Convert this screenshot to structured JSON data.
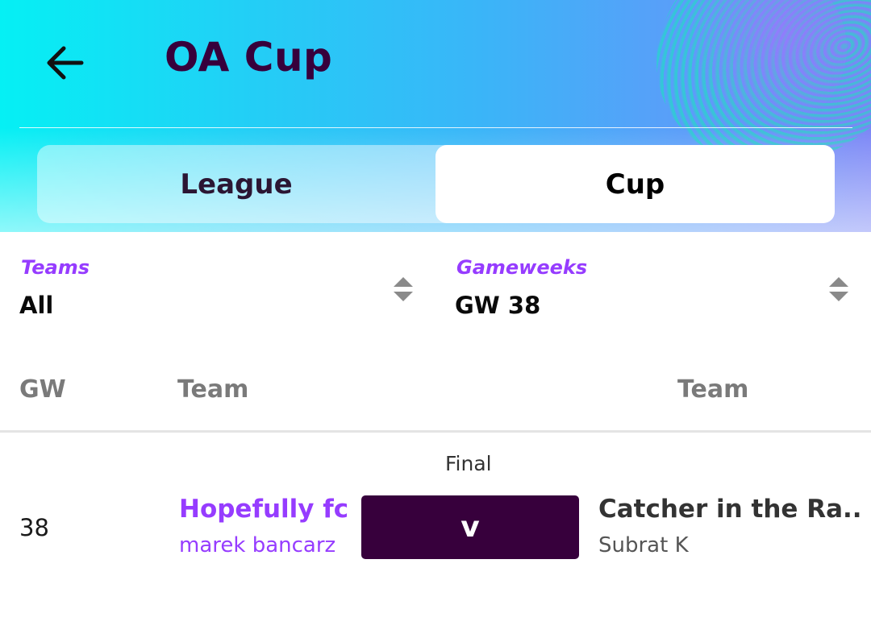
{
  "header": {
    "title": "OA Cup",
    "back_icon": "arrow-left-icon"
  },
  "tabs": [
    {
      "label": "League",
      "active": false
    },
    {
      "label": "Cup",
      "active": true
    }
  ],
  "filters": {
    "teams": {
      "label": "Teams",
      "value": "All",
      "icon": "sort-arrows-icon"
    },
    "gameweeks": {
      "label": "Gameweeks",
      "value": "GW 38",
      "icon": "sort-arrows-icon"
    }
  },
  "table": {
    "headers": [
      "GW",
      "Team",
      "Team"
    ]
  },
  "fixtures": [
    {
      "round": "Final",
      "gw": "38",
      "home": {
        "team": "Hopefully fc",
        "manager": "marek bancarz"
      },
      "vs": "v",
      "away": {
        "team": "Catcher in the Ra..",
        "manager": "Subrat K"
      }
    }
  ],
  "colors": {
    "primary_purple": "#37003c",
    "accent_purple": "#963cff",
    "muted_gray": "#7a7a7a"
  }
}
